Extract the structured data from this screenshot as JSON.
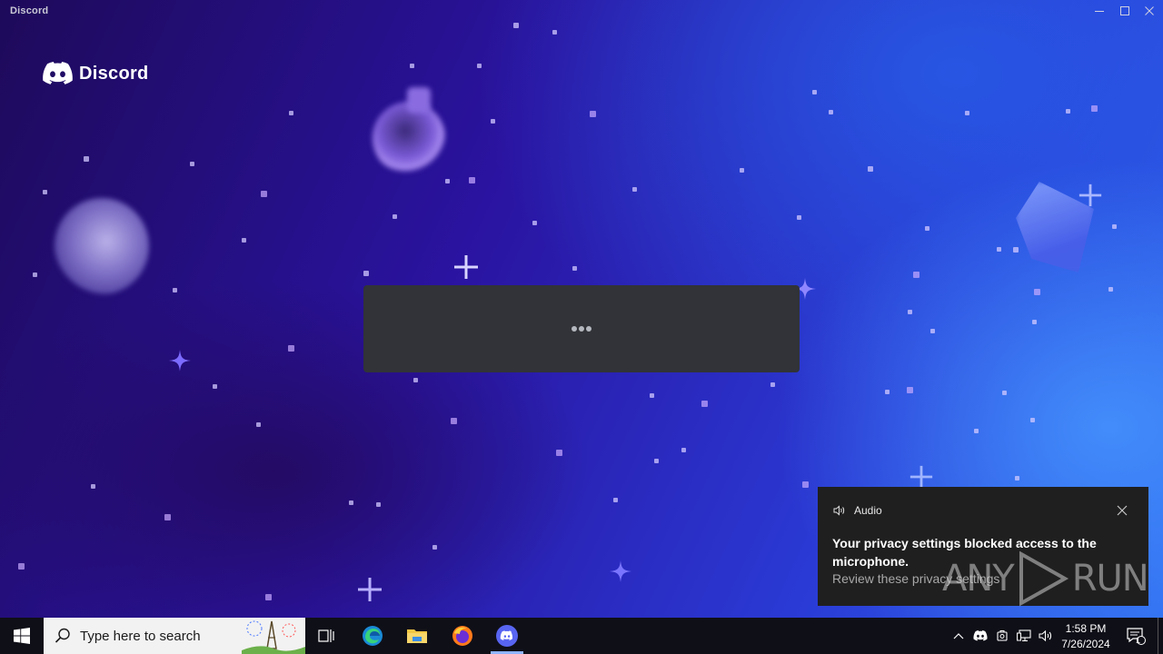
{
  "window": {
    "title": "Discord",
    "controls": [
      "minimize-icon",
      "maximize-icon",
      "close-icon"
    ]
  },
  "brand": {
    "name": "Discord",
    "logo_icon": "discord-logo-icon",
    "color": "#ffffff"
  },
  "loading": {
    "card_color": "#313338",
    "indicator": "ellipsis-icon"
  },
  "notification": {
    "app": "Audio",
    "app_icon": "speaker-icon",
    "title": "Your privacy settings blocked access to the microphone.",
    "body": "Review these privacy settings",
    "close_icon": "close-icon",
    "watermark": "ANY RUN"
  },
  "taskbar": {
    "start_icon": "windows-logo-icon",
    "search_placeholder": "Type here to search",
    "pinned": [
      "task-view-icon",
      "edge-icon",
      "file-explorer-icon",
      "firefox-icon",
      "discord-icon"
    ],
    "active_app": "discord-icon",
    "tray_icons": [
      "chevron-up-icon",
      "discord-tray-icon",
      "meet-now-icon",
      "network-icon",
      "volume-icon"
    ],
    "time": "1:58 PM",
    "date": "7/26/2024",
    "notifications_count": "1"
  },
  "colors": {
    "accent": "#5865f2",
    "taskbar_bg": "#0f0f18",
    "toast_bg": "#1f1f1f"
  }
}
